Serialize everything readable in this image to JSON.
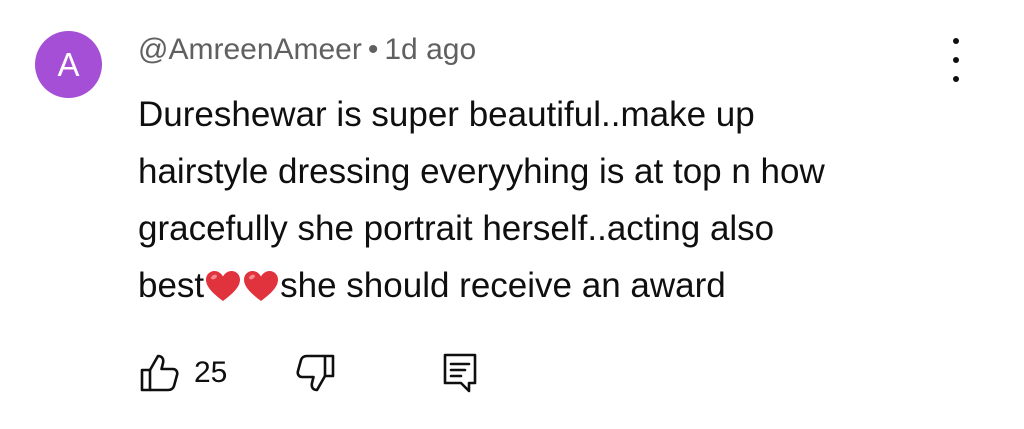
{
  "comment": {
    "avatar_letter": "A",
    "avatar_color": "#a44fd6",
    "author": "@AmreenAmeer",
    "separator": "•",
    "time": "1d ago",
    "lines": [
      "Dureshewar is super beautiful..make up",
      "hairstyle dressing everyyhing is at top n how",
      "gracefully she portrait herself..acting also"
    ],
    "last_line_start": "best",
    "last_line_end": "she should receive an award",
    "heart_color": "#e0333d",
    "like_count": "25"
  },
  "icons": {
    "more": "vertical-dots-icon",
    "like": "thumbs-up-icon",
    "dislike": "thumbs-down-icon",
    "reply": "reply-comment-icon",
    "heart": "red-heart-icon"
  }
}
